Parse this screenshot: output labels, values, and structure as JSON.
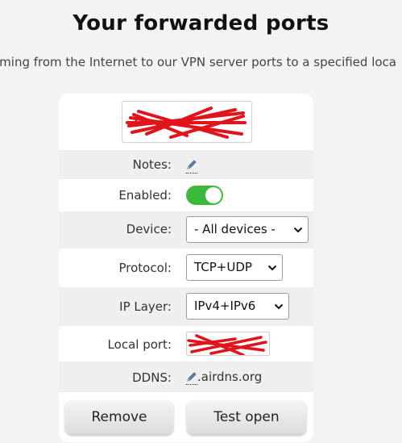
{
  "header": {
    "title": "Your forwarded ports",
    "subtitle": "oming from the Internet to our VPN server ports to a specified loca"
  },
  "form": {
    "name_value": "·····",
    "notes_label": "Notes:",
    "enabled_label": "Enabled:",
    "enabled_state": true,
    "device_label": "Device:",
    "device_selected": "- All devices -",
    "protocol_label": "Protocol:",
    "protocol_selected": "TCP+UDP",
    "ip_layer_label": "IP Layer:",
    "ip_layer_selected": "IPv4+IPv6",
    "local_port_label": "Local port:",
    "local_port_value": "·····",
    "ddns_label": "DDNS:",
    "ddns_value": ".airdns.org"
  },
  "buttons": {
    "remove": "Remove",
    "test_open": "Test open"
  },
  "colors": {
    "toggle_on": "#3cb83c",
    "redaction": "#e0141b"
  },
  "icons": {
    "edit": "pencil-icon",
    "dropdown": "chevron-down-icon"
  }
}
